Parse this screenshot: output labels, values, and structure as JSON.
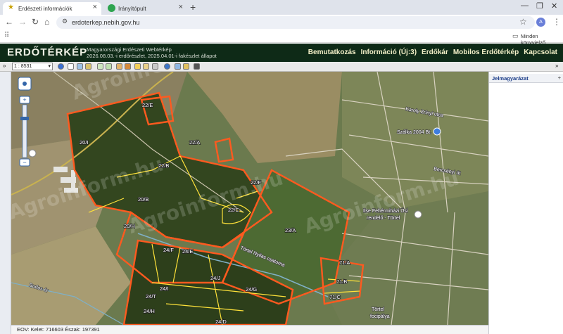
{
  "browser": {
    "tabs": [
      {
        "title": "Erdészeti információk",
        "active": true
      },
      {
        "title": "Irányítópult",
        "active": false
      }
    ],
    "url": "erdoterkep.nebih.gov.hu",
    "bookmarks_label": "Minden könyvjelző",
    "profile_initial": "A"
  },
  "header": {
    "logo": "ERDŐTÉRKÉP",
    "subtitle_line1": "Magyarországi Erdészeti Webtérkép",
    "subtitle_line2": "2026.08.03.-i erdőrészlet, 2025.04.01-i fakészlet állapot",
    "nav": [
      "Bemutatkozás",
      "Információ (Új:3)",
      "Erdőkár",
      "Mobilos Erdőtérkép",
      "Kapcsolat"
    ]
  },
  "toolbar": {
    "scale": "1 : 8531"
  },
  "legend": {
    "title": "Jelmagyarázat"
  },
  "status": {
    "text": "EOV: Kelet: 716603   Észak: 197391"
  },
  "map": {
    "labels": [
      "22/E",
      "22/A",
      "22/B",
      "20/I",
      "20/B",
      "22/F",
      "22/C",
      "20/H",
      "23/A",
      "24/F",
      "24/E",
      "24/J",
      "24/I",
      "24/G",
      "24/T",
      "24/H",
      "24/D",
      "71/A",
      "71/B",
      "71/C"
    ],
    "places": [
      "Szálka 2004 Bt.",
      "Ilse Fehérmiházi Úsi",
      "rendelő - Törtel",
      "Törtel",
      "focipálya"
    ],
    "roads": [
      "Törtel Nyilas csatorna",
      "Budos ér",
      "Karoly Zrínyi utca",
      "Bercsényi út"
    ],
    "watermark": "Agroinform.hu",
    "colors": {
      "parcel_orange": "#ff5a1f",
      "subparcel_yellow": "#ffe23a",
      "header_bg": "#0e2a17"
    }
  }
}
